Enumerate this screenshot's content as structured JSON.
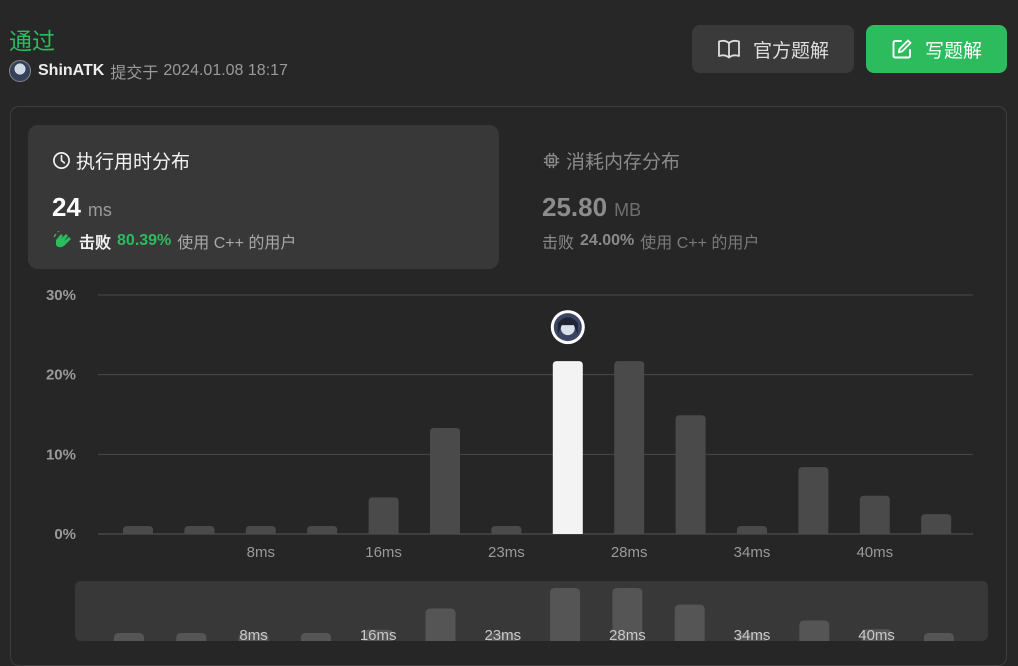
{
  "header": {
    "status": "通过",
    "username": "ShinATK",
    "submitted_label": "提交于",
    "submitted_time": "2024.01.08 18:17"
  },
  "buttons": {
    "solution_label": "官方题解",
    "write_label": "写题解"
  },
  "runtime_card": {
    "title": "执行用时分布",
    "value": "24",
    "unit": "ms",
    "beat_word": "击败",
    "beat_percent": "80.39%",
    "beat_suffix": "使用 C++ 的用户"
  },
  "memory_card": {
    "title": "消耗内存分布",
    "value": "25.80",
    "unit": "MB",
    "beat_word": "击败",
    "beat_percent": "24.00%",
    "beat_suffix": "使用 C++ 的用户"
  },
  "colors": {
    "accent": "#2cbb5d",
    "bar": "#4a4a4a",
    "highlight_bar": "#f3f3f3",
    "grid": "#4a4a4a"
  },
  "chart_data": {
    "type": "bar",
    "y_ticks": [
      "30%",
      "20%",
      "10%",
      "0%"
    ],
    "ylim": [
      0,
      30
    ],
    "grid": true,
    "x_tick_labels": [
      {
        "index": 2,
        "label": "8ms"
      },
      {
        "index": 4,
        "label": "16ms"
      },
      {
        "index": 6,
        "label": "23ms"
      },
      {
        "index": 8,
        "label": "28ms"
      },
      {
        "index": 10,
        "label": "34ms"
      },
      {
        "index": 12,
        "label": "40ms"
      }
    ],
    "values": [
      1,
      1,
      1,
      1,
      4.6,
      13.3,
      1,
      21.7,
      21.7,
      14.9,
      1,
      8.4,
      4.8,
      2.5
    ],
    "highlight_index": 7,
    "marker": "user-avatar"
  }
}
